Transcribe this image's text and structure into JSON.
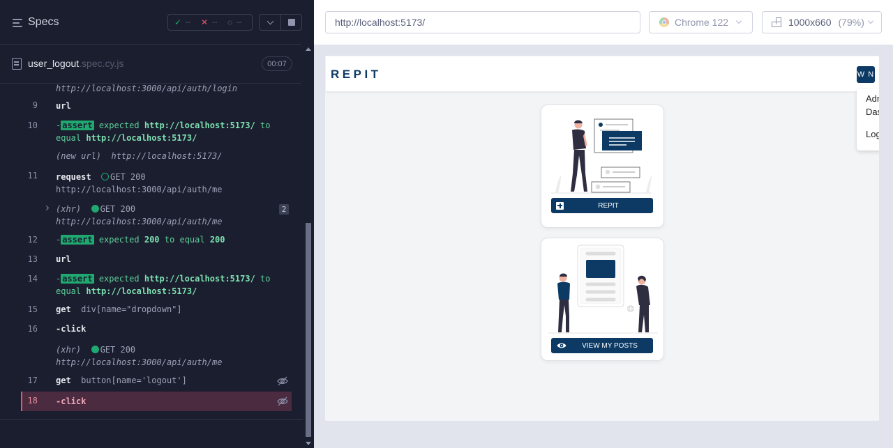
{
  "runner": {
    "title": "Specs",
    "stats": {
      "passed": "--",
      "failed": "--",
      "pending": "--"
    },
    "spec_file": {
      "name": "user_logout",
      "ext": ".spec.cy.js",
      "duration": "00:07"
    }
  },
  "log": {
    "prev_line": "http://localhost:3000/api/auth/login",
    "c9": {
      "num": "9",
      "name": "url"
    },
    "c10": {
      "num": "10",
      "dash": "-",
      "tag": "assert",
      "expected": "expected",
      "actual": "http://localhost:5173/",
      "to": "to",
      "equal": "equal",
      "val": "http://localhost:5173/"
    },
    "newurl": {
      "label": "(new url)",
      "value": "http://localhost:5173/"
    },
    "c11": {
      "num": "11",
      "name": "request",
      "method": "GET 200",
      "url": "http://localhost:3000/api/auth/me"
    },
    "xhr1": {
      "label": "(xhr)",
      "method": "GET 200",
      "url": "http://localhost:3000/api/auth/me",
      "count": "2"
    },
    "c12": {
      "num": "12",
      "dash": "-",
      "tag": "assert",
      "expected": "expected",
      "a": "200",
      "mid": "to equal",
      "b": "200"
    },
    "c13": {
      "num": "13",
      "name": "url"
    },
    "c14": {
      "num": "14",
      "dash": "-",
      "tag": "assert",
      "expected": "expected",
      "actual": "http://localhost:5173/",
      "to": "to",
      "equal": "equal",
      "val": "http://localhost:5173/"
    },
    "c15": {
      "num": "15",
      "name": "get",
      "arg": "div[name=\"dropdown\"]"
    },
    "c16": {
      "num": "16",
      "name": "-click"
    },
    "xhr2": {
      "label": "(xhr)",
      "method": "GET 200",
      "url": "http://localhost:3000/api/auth/me"
    },
    "c17": {
      "num": "17",
      "name": "get",
      "arg": "button[name='logout']"
    },
    "c18": {
      "num": "18",
      "name": "-click"
    }
  },
  "preview": {
    "url": "http://localhost:5173/",
    "browser": "Chrome 122",
    "viewport": "1000x660",
    "zoom": "(79%)"
  },
  "app": {
    "brand": "REPIT",
    "avatar": "W N",
    "dropdown": {
      "line1": "Adm",
      "line2": "Das",
      "line3": "Log"
    },
    "card1_btn": "REPIT",
    "card2_btn": "VIEW MY POSTS"
  },
  "colors": {
    "accent": "#0c3a64",
    "pass": "#1fa971",
    "fail": "#e45770"
  }
}
